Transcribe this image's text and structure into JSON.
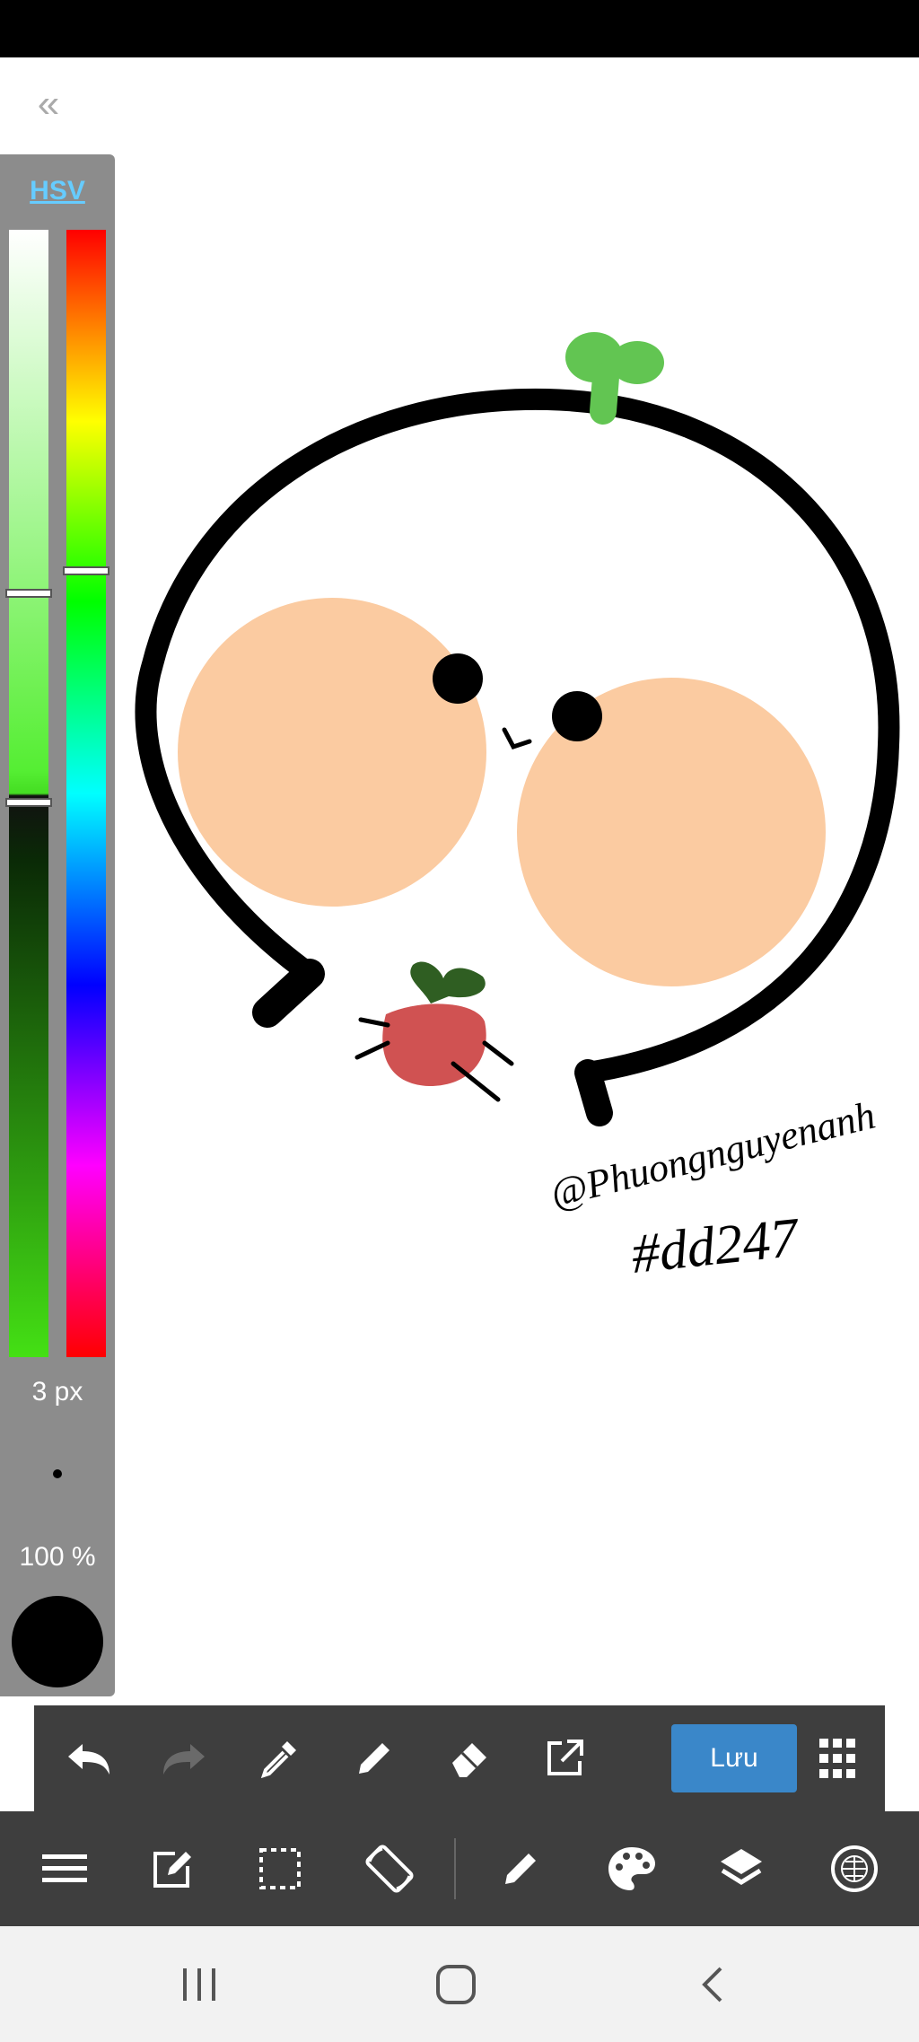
{
  "color_panel": {
    "mode_tab": "HSV",
    "brush_size": "3 px",
    "opacity": "100 %",
    "current_color": "#000000"
  },
  "canvas": {
    "signature": "@Phuongnguyenanh",
    "tag": "#dd247"
  },
  "toolbar": {
    "save_label": "Lưu",
    "icons": [
      "undo-icon",
      "redo-icon",
      "eyedropper-icon",
      "pen-icon",
      "eraser-icon",
      "export-icon",
      "grid-menu-icon"
    ]
  },
  "bottom_bar": {
    "icons": [
      "menu-icon",
      "edit-icon",
      "selection-icon",
      "rotate-icon",
      "brush-icon",
      "palette-icon",
      "layers-icon",
      "materials-icon"
    ]
  },
  "nav_bar": {
    "icons": [
      "recent-apps-icon",
      "home-icon",
      "back-icon"
    ]
  }
}
